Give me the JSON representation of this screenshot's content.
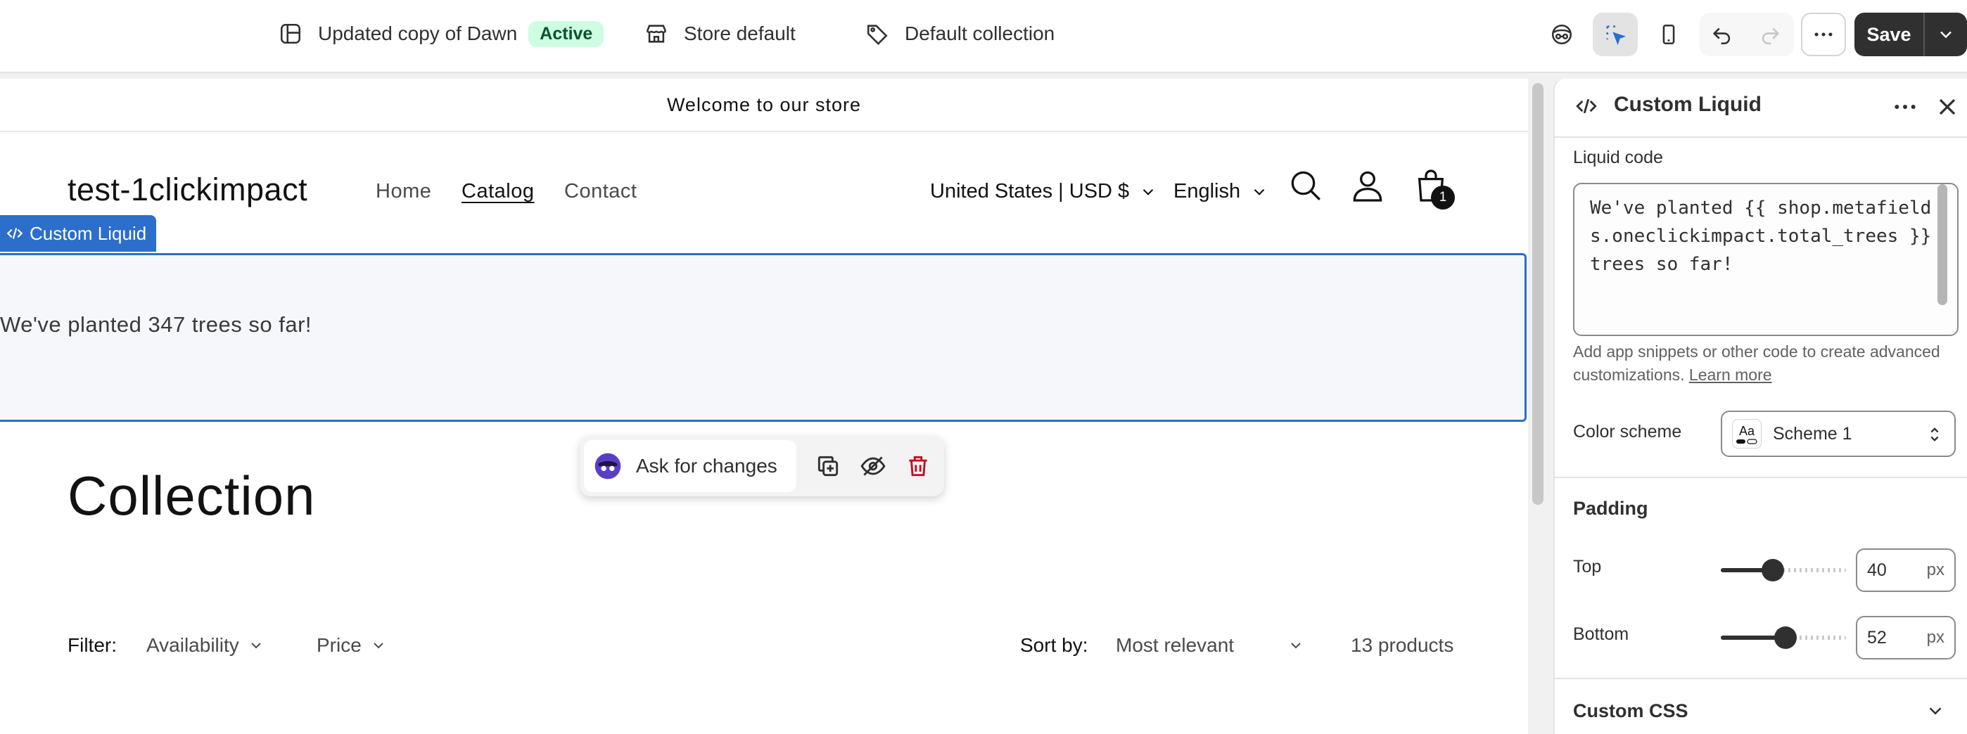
{
  "topbar": {
    "theme_name": "Updated copy of Dawn",
    "theme_status": "Active",
    "store_selector": "Store default",
    "template_selector": "Default collection",
    "save_label": "Save"
  },
  "preview": {
    "announcement": "Welcome to our store",
    "store_name": "test-1clickimpact",
    "nav": [
      "Home",
      "Catalog",
      "Contact"
    ],
    "country_currency": "United States | USD $",
    "language": "English",
    "cart_count": "1",
    "selected_section_tag": "Custom Liquid",
    "planted_text": "We've planted 347 trees so far!",
    "floating_toolbar": {
      "ask_label": "Ask for changes"
    },
    "collection_title": "Collection",
    "filter": {
      "label": "Filter:",
      "availability": "Availability",
      "price": "Price"
    },
    "sort": {
      "label": "Sort by:",
      "value": "Most relevant"
    },
    "product_count": "13 products"
  },
  "panel": {
    "title": "Custom Liquid",
    "liquid_code_label": "Liquid code",
    "liquid_code_value": "We've planted {{ shop.metafields.oneclickimpact.total_trees }} trees so far!",
    "help_text": "Add app snippets or other code to create advanced customizations.",
    "learn_more": "Learn more",
    "color_scheme_label": "Color scheme",
    "color_scheme_value": "Scheme 1",
    "scheme_swatch_text": "Aa",
    "padding_heading": "Padding",
    "top_label": "Top",
    "top_value": "40",
    "top_fraction": 0.4,
    "bottom_label": "Bottom",
    "bottom_value": "52",
    "bottom_fraction": 0.52,
    "unit": "px",
    "custom_css_heading": "Custom CSS"
  },
  "colors": {
    "selection_blue": "#2c6ecb",
    "active_badge_bg": "#cdfee1",
    "save_button_bg": "#303030",
    "delete_red": "#c70a24"
  }
}
